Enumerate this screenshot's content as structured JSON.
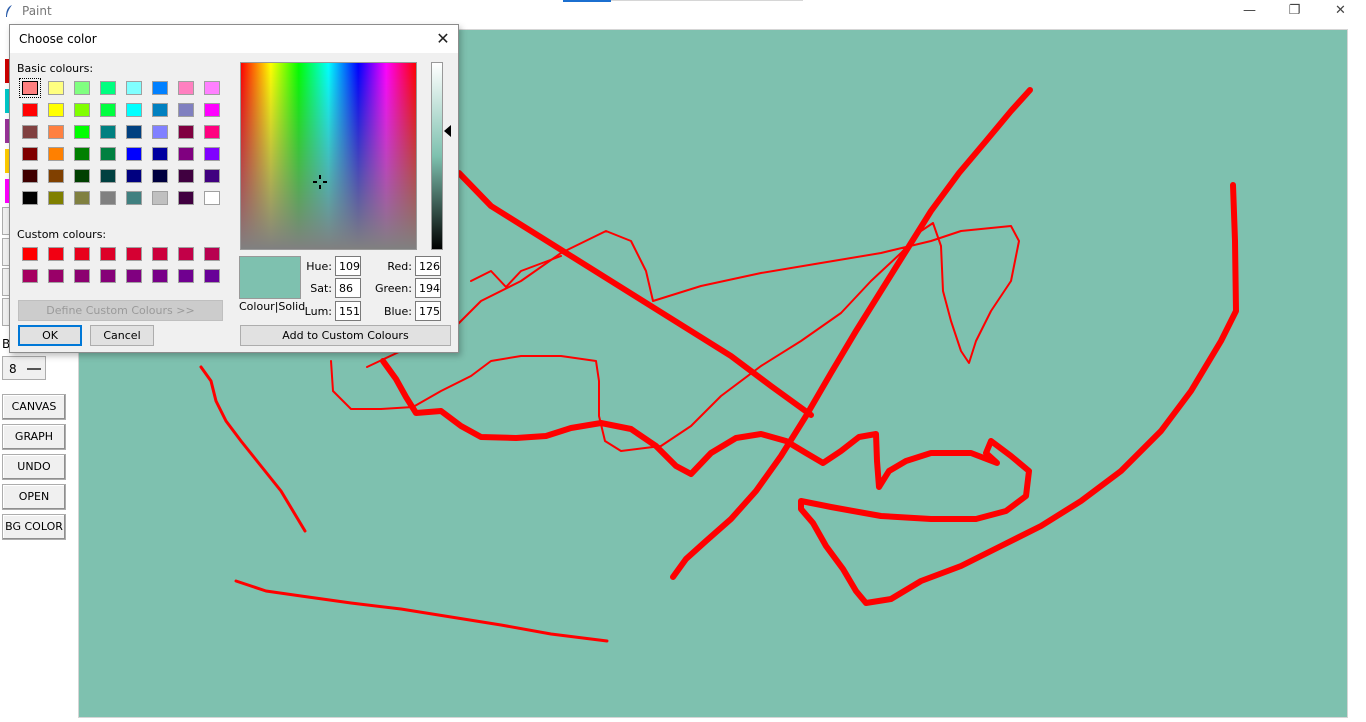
{
  "window": {
    "title": "Paint",
    "minimize_icon": "minimize-icon",
    "restore_icon": "restore-icon",
    "close_icon": "close-icon"
  },
  "sidebar": {
    "swatch_colors": [
      "#cc0000",
      "#00c8c8",
      "#993399",
      "#ffcc00",
      "#ff00ff"
    ],
    "brush_label": "B",
    "brush_size": "8",
    "buttons": [
      "CANVAS",
      "GRAPH",
      "UNDO",
      "OPEN",
      "BG COLOR"
    ]
  },
  "canvas": {
    "background": "#7ec1af",
    "stroke_color": "#ff0000"
  },
  "dialog": {
    "title": "Choose color",
    "basic_label": "Basic colours:",
    "custom_label": "Custom colours:",
    "basic_colors": [
      [
        "#ff8080",
        "#ffff80",
        "#80ff80",
        "#00ff80",
        "#80ffff",
        "#0080ff",
        "#ff80c0",
        "#ff80ff"
      ],
      [
        "#ff0000",
        "#ffff00",
        "#80ff00",
        "#00ff40",
        "#00ffff",
        "#0080c0",
        "#8080c0",
        "#ff00ff"
      ],
      [
        "#804040",
        "#ff8040",
        "#00ff00",
        "#008080",
        "#004080",
        "#8080ff",
        "#800040",
        "#ff0080"
      ],
      [
        "#800000",
        "#ff8000",
        "#008000",
        "#008040",
        "#0000ff",
        "#0000a0",
        "#800080",
        "#8000ff"
      ],
      [
        "#400000",
        "#804000",
        "#004000",
        "#004040",
        "#000080",
        "#000040",
        "#400040",
        "#400080"
      ],
      [
        "#000000",
        "#808000",
        "#808040",
        "#808080",
        "#408080",
        "#c0c0c0",
        "#400040",
        "#ffffff"
      ]
    ],
    "custom_colors": [
      [
        "#ff0000",
        "#f20012",
        "#e8001c",
        "#dd0028",
        "#d50032",
        "#cc003c",
        "#c20048",
        "#b80050"
      ],
      [
        "#a60060",
        "#990068",
        "#8c0070",
        "#860078",
        "#800080",
        "#780088",
        "#700090",
        "#680098"
      ]
    ],
    "define_button": "Define Custom Colours >>",
    "ok_button": "OK",
    "cancel_button": "Cancel",
    "colour_solid_label": "Colour|Solid",
    "hue_label": "Hue:",
    "hue": "109",
    "sat_label": "Sat:",
    "sat": "86",
    "lum_label": "Lum:",
    "lum": "151",
    "red_label": "Red:",
    "red": "126",
    "green_label": "Green:",
    "green": "194",
    "blue_label": "Blue:",
    "blue": "175",
    "add_custom_button": "Add to Custom Colours",
    "preview_color": "#7ec1af"
  }
}
